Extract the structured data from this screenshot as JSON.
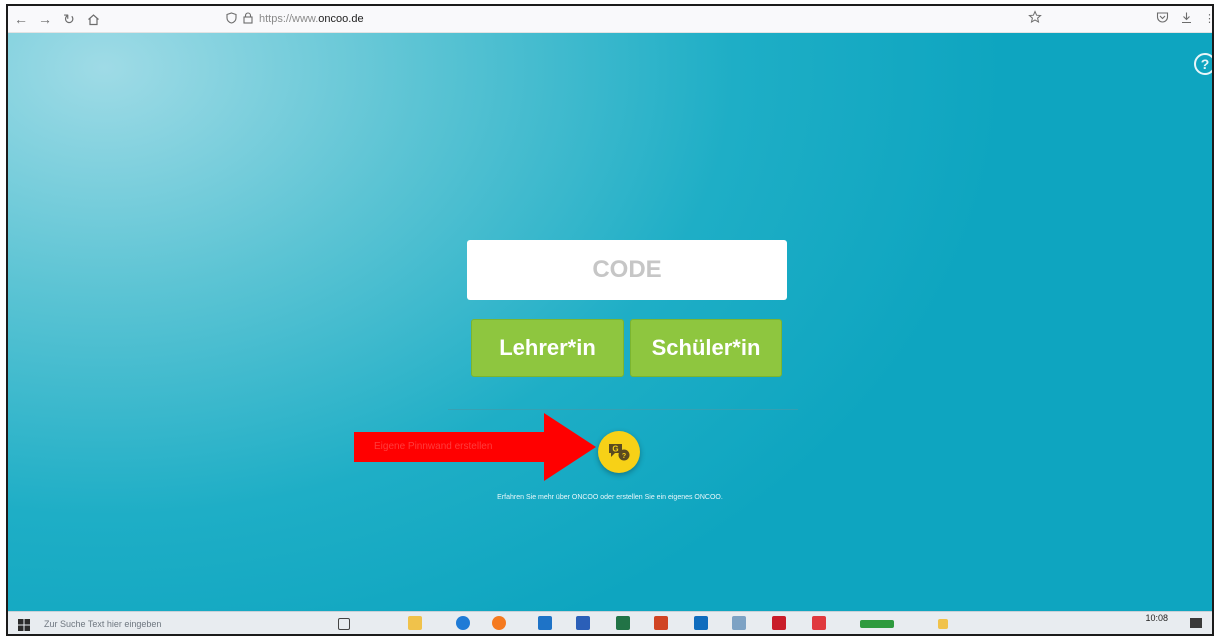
{
  "browser": {
    "url_prefix": "https://www.",
    "url_host": "oncoo.de"
  },
  "main": {
    "code_placeholder": "CODE",
    "teacher_button": "Lehrer*in",
    "student_button": "Schüler*in",
    "arrow_label": "Eigene Pinnwand erstellen",
    "hint_text": "Erfahren Sie mehr über ONCOO oder erstellen Sie ein eigenes ONCOO."
  },
  "taskbar": {
    "search_placeholder": "Zur Suche Text hier eingeben",
    "clock_time": "10:08"
  },
  "colors": {
    "accent_green": "#8ec63f",
    "accent_yellow": "#f7d117",
    "arrow_red": "#ff0000",
    "page_teal": "#0ea5c0"
  }
}
